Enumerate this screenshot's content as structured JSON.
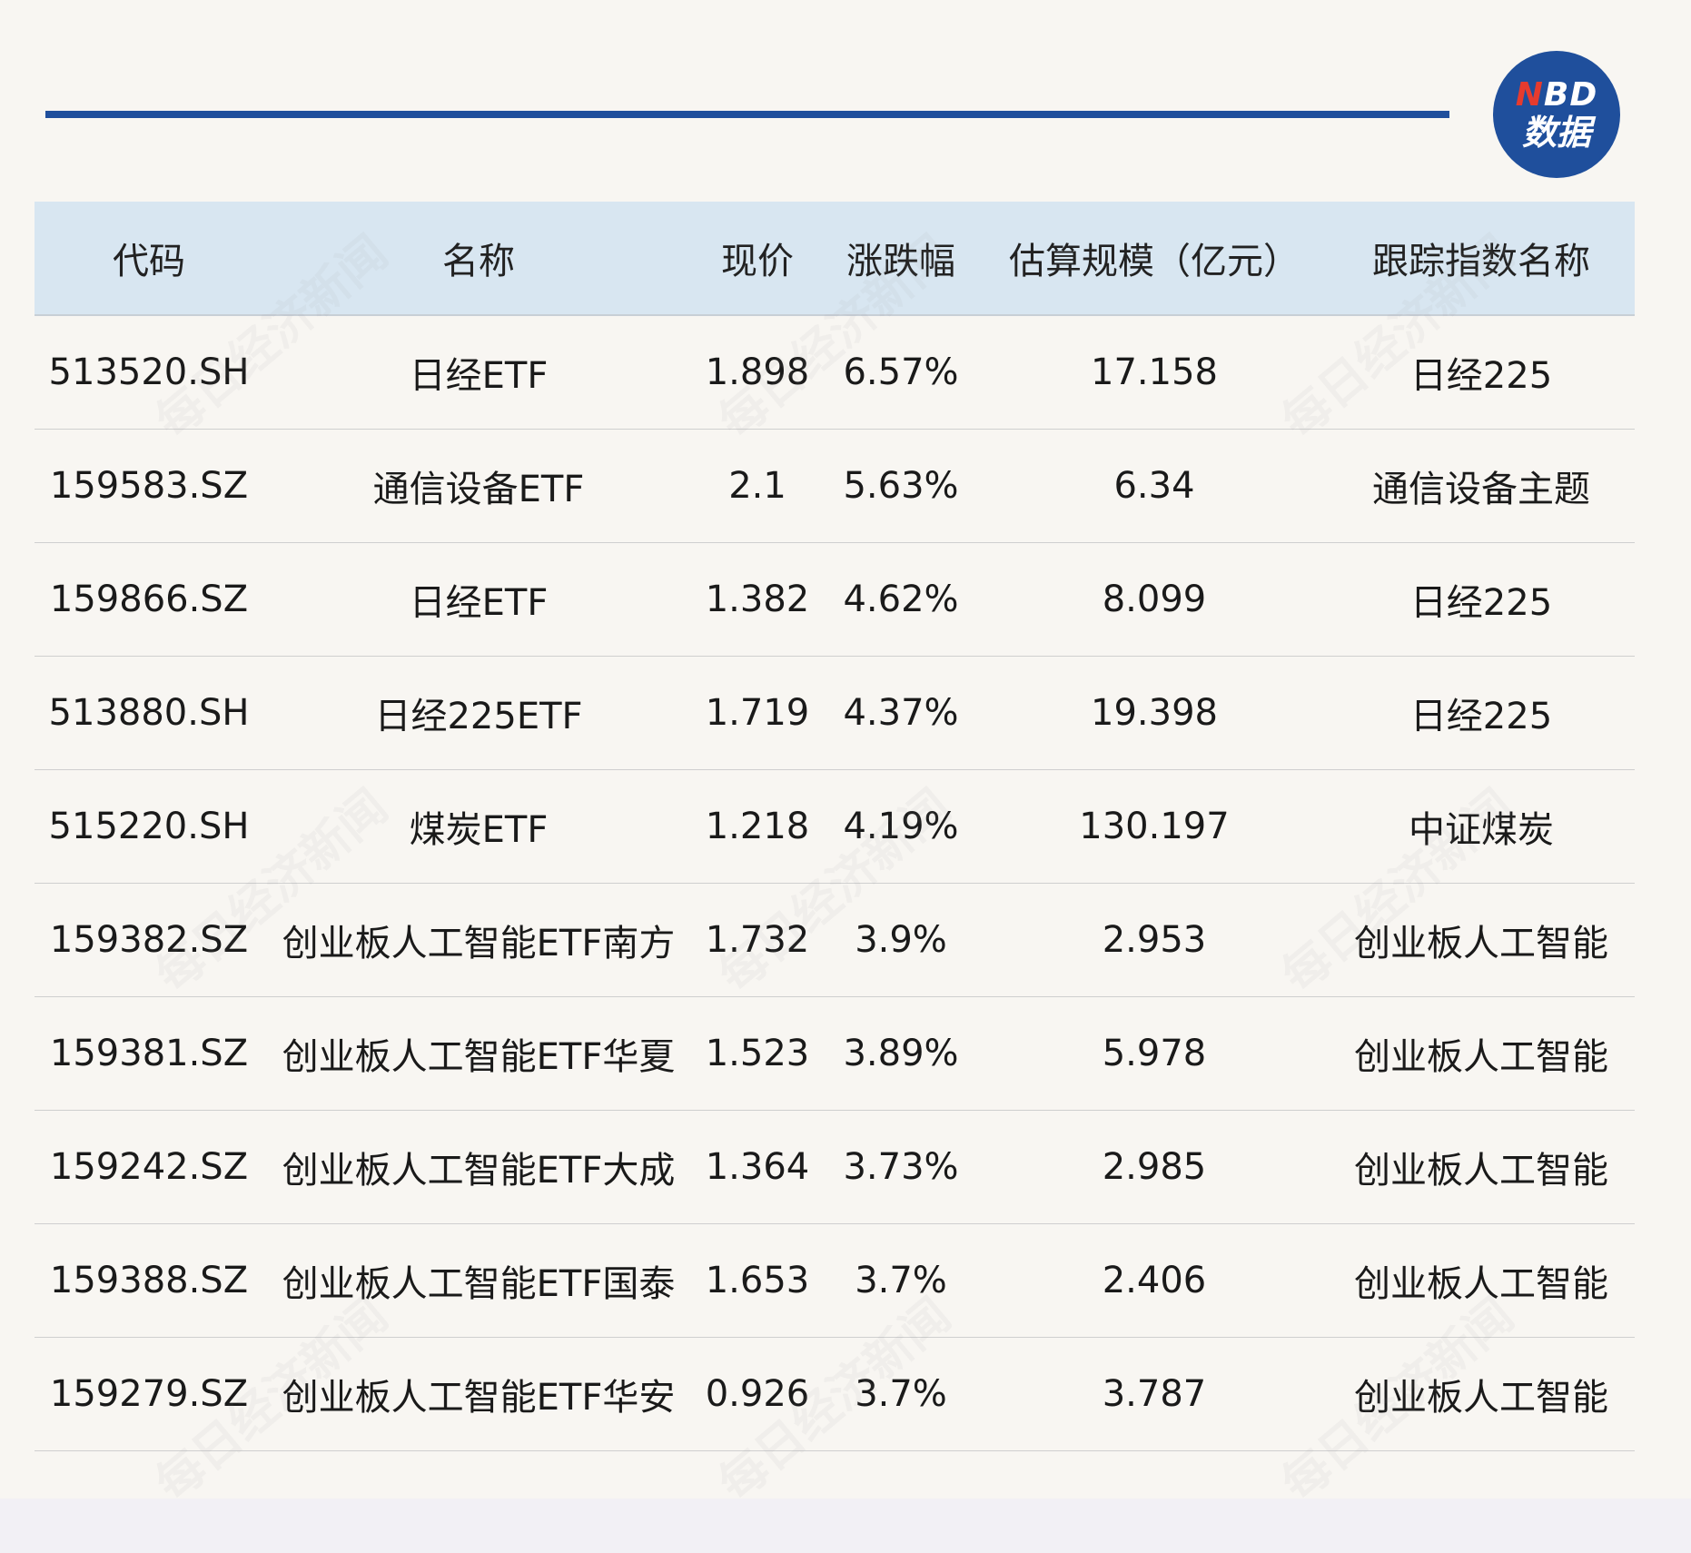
{
  "logo": {
    "n": "N",
    "bd": "BD",
    "sub": "数据"
  },
  "watermark": "每日经济新闻",
  "table": {
    "headers": [
      "代码",
      "名称",
      "现价",
      "涨跌幅",
      "估算规模（亿元）",
      "跟踪指数名称"
    ],
    "rows": [
      [
        "513520.SH",
        "日经ETF",
        "1.898",
        "6.57%",
        "17.158",
        "日经225"
      ],
      [
        "159583.SZ",
        "通信设备ETF",
        "2.1",
        "5.63%",
        "6.34",
        "通信设备主题"
      ],
      [
        "159866.SZ",
        "日经ETF",
        "1.382",
        "4.62%",
        "8.099",
        "日经225"
      ],
      [
        "513880.SH",
        "日经225ETF",
        "1.719",
        "4.37%",
        "19.398",
        "日经225"
      ],
      [
        "515220.SH",
        "煤炭ETF",
        "1.218",
        "4.19%",
        "130.197",
        "中证煤炭"
      ],
      [
        "159382.SZ",
        "创业板人工智能ETF南方",
        "1.732",
        "3.9%",
        "2.953",
        "创业板人工智能"
      ],
      [
        "159381.SZ",
        "创业板人工智能ETF华夏",
        "1.523",
        "3.89%",
        "5.978",
        "创业板人工智能"
      ],
      [
        "159242.SZ",
        "创业板人工智能ETF大成",
        "1.364",
        "3.73%",
        "2.985",
        "创业板人工智能"
      ],
      [
        "159388.SZ",
        "创业板人工智能ETF国泰",
        "1.653",
        "3.7%",
        "2.406",
        "创业板人工智能"
      ],
      [
        "159279.SZ",
        "创业板人工智能ETF华安",
        "0.926",
        "3.7%",
        "3.787",
        "创业板人工智能"
      ]
    ]
  },
  "colors": {
    "accent": "#1f4f9c",
    "header_bg": "#d8e6f1",
    "page_bg": "#f8f6f2",
    "logo_red": "#e63b2e"
  }
}
